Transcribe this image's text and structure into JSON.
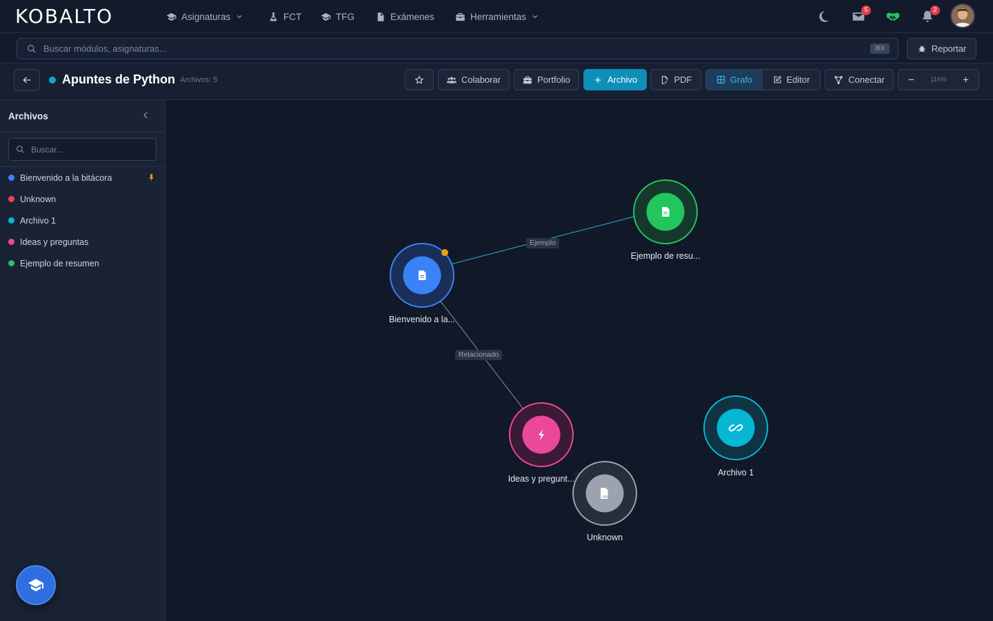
{
  "brand": "KOBALTO",
  "nav": {
    "items": [
      {
        "label": "Asignaturas",
        "icon": "graduation-cap-icon",
        "has_dropdown": true
      },
      {
        "label": "FCT",
        "icon": "flask-icon"
      },
      {
        "label": "TFG",
        "icon": "graduation-cap-icon"
      },
      {
        "label": "Exámenes",
        "icon": "document-icon"
      },
      {
        "label": "Herramientas",
        "icon": "toolbox-icon",
        "has_dropdown": true
      }
    ],
    "messages_count": "5",
    "notifications_count": "2"
  },
  "search": {
    "placeholder": "Buscar módulos, asignaturas...",
    "shortcut": "⌘K"
  },
  "report_label": "Reportar",
  "note": {
    "title": "Apuntes de Python",
    "count_label": "Archivos: 5",
    "dot_color": "#0ea5d3"
  },
  "toolbar": {
    "collaborate_label": "Colaborar",
    "portfolio_label": "Portfolio",
    "add_file_label": "Archivo",
    "pdf_label": "PDF",
    "graph_label": "Grafo",
    "editor_label": "Editor",
    "connect_label": "Conectar",
    "zoom_label": "116%"
  },
  "sidebar": {
    "title": "Archivos",
    "search_placeholder": "Buscar...",
    "files": [
      {
        "label": "Bienvenido a la bitácora",
        "color": "#3b82f6",
        "pinned": true
      },
      {
        "label": "Unknown",
        "color": "#ef4444",
        "pinned": false
      },
      {
        "label": "Archivo 1",
        "color": "#06b6d4",
        "pinned": false
      },
      {
        "label": "Ideas y preguntas",
        "color": "#ec4899",
        "pinned": false
      },
      {
        "label": "Ejemplo de resumen",
        "color": "#22c55e",
        "pinned": false
      }
    ]
  },
  "graph": {
    "nodes": [
      {
        "id": "bienvenido",
        "label": "Bienvenido a la...",
        "color": "#3b82f6",
        "icon": "document-icon"
      },
      {
        "id": "ejemplo",
        "label": "Ejemplo de resu...",
        "color": "#22c55e",
        "icon": "document-icon"
      },
      {
        "id": "ideas",
        "label": "Ideas y pregunt...",
        "color": "#ec4899",
        "icon": "bolt-icon"
      },
      {
        "id": "archivo1",
        "label": "Archivo 1",
        "color": "#06b6d4",
        "icon": "link-icon"
      },
      {
        "id": "unknown",
        "label": "Unknown",
        "color": "#9ca3af",
        "icon": "pdf-icon"
      }
    ],
    "edges": [
      {
        "from": "bienvenido",
        "to": "ejemplo",
        "label": "Ejemplo"
      },
      {
        "from": "bienvenido",
        "to": "ideas",
        "label": "Relacionado"
      }
    ]
  }
}
